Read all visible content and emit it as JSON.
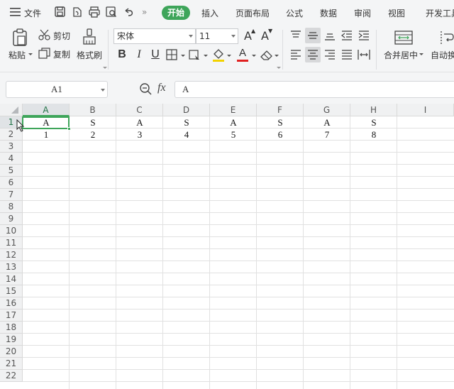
{
  "menu": {
    "file_label": "文件",
    "more_label": "»",
    "tabs": [
      "开始",
      "插入",
      "页面布局",
      "公式",
      "数据",
      "审阅",
      "视图",
      "开发工具"
    ]
  },
  "ribbon": {
    "paste_label": "粘贴",
    "cut_label": "剪切",
    "copy_label": "复制",
    "format_painter_label": "格式刷",
    "font_name": "宋体",
    "font_size": "11",
    "bold_label": "B",
    "italic_label": "I",
    "underline_label": "U",
    "font_color_label": "A",
    "font_grow_label": "A",
    "font_shrink_label": "A",
    "merge_center_label": "合并居中",
    "auto_wrap_label": "自动换"
  },
  "formula_bar": {
    "name_box": "A1",
    "fx_label": "fx",
    "formula": "A"
  },
  "sheet": {
    "columns": [
      "A",
      "B",
      "C",
      "D",
      "E",
      "F",
      "G",
      "H",
      "I"
    ],
    "rows": [
      "1",
      "2",
      "3",
      "4",
      "5",
      "6",
      "7",
      "8",
      "9",
      "10",
      "11",
      "12",
      "13",
      "14",
      "15",
      "16",
      "17",
      "18",
      "19",
      "20",
      "21",
      "22"
    ],
    "row1": [
      "A",
      "S",
      "A",
      "S",
      "A",
      "S",
      "A",
      "S"
    ],
    "row2": [
      "1",
      "2",
      "3",
      "4",
      "5",
      "6",
      "7",
      "8"
    ]
  },
  "colors": {
    "accent": "#3ea55a",
    "font_color_bar": "#e02020",
    "highlight_bar": "#f2d200"
  }
}
